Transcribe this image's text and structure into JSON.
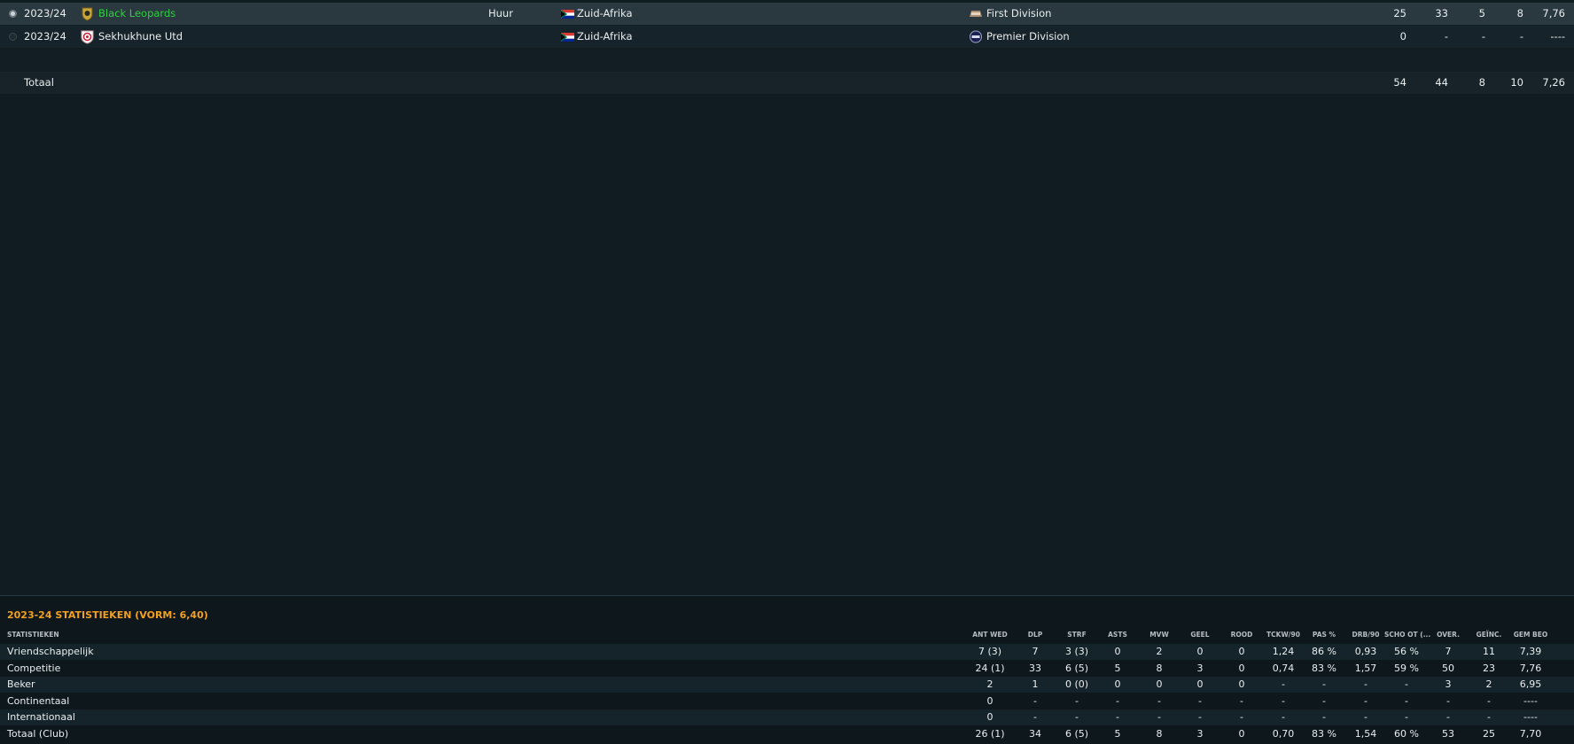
{
  "career": {
    "rows": [
      {
        "season": "2023/24",
        "club": "Black Leopards",
        "club_color": "#2ed03e",
        "loan": "Huur",
        "nation": "Zuid-Afrika",
        "league": "First Division",
        "v1": "25",
        "v2": "33",
        "v3": "5",
        "v4": "8",
        "v5": "7,76",
        "selected": true
      },
      {
        "season": "2023/24",
        "club": "Sekhukhune Utd",
        "club_color": "#e9eef0",
        "loan": "",
        "nation": "Zuid-Afrika",
        "league": "Premier Division",
        "v1": "0",
        "v2": "-",
        "v3": "-",
        "v4": "-",
        "v5": "----",
        "selected": false
      }
    ],
    "total": {
      "label": "Totaal",
      "v1": "54",
      "v2": "44",
      "v3": "8",
      "v4": "10",
      "v5": "7,26"
    }
  },
  "stats": {
    "title": "2023-24 STATISTIEKEN (VORM: 6,40)",
    "row_header": "STATISTIEKEN",
    "columns": [
      "ANT WED",
      "DLP",
      "STRF",
      "ASTS",
      "MVW",
      "GEEL",
      "ROOD",
      "TCKW/90",
      "PAS %",
      "DRB/90",
      "SCHO OT (...",
      "OVER.",
      "GEÏNC.",
      "GEM BEO"
    ],
    "rows": [
      {
        "label": "Vriendschappelijk",
        "values": [
          "7 (3)",
          "7",
          "3 (3)",
          "0",
          "2",
          "0",
          "0",
          "1,24",
          "86 %",
          "0,93",
          "56 %",
          "7",
          "11",
          "7,39"
        ]
      },
      {
        "label": "Competitie",
        "values": [
          "24 (1)",
          "33",
          "6 (5)",
          "5",
          "8",
          "3",
          "0",
          "0,74",
          "83 %",
          "1,57",
          "59 %",
          "50",
          "23",
          "7,76"
        ]
      },
      {
        "label": "Beker",
        "values": [
          "2",
          "1",
          "0 (0)",
          "0",
          "0",
          "0",
          "0",
          "-",
          "-",
          "-",
          "-",
          "3",
          "2",
          "6,95"
        ]
      },
      {
        "label": "Continentaal",
        "values": [
          "0",
          "-",
          "-",
          "-",
          "-",
          "-",
          "-",
          "-",
          "-",
          "-",
          "-",
          "-",
          "-",
          "----"
        ]
      },
      {
        "label": "Internationaal",
        "values": [
          "0",
          "-",
          "-",
          "-",
          "-",
          "-",
          "-",
          "-",
          "-",
          "-",
          "-",
          "-",
          "-",
          "----"
        ]
      },
      {
        "label": "Totaal (Club)",
        "values": [
          "26 (1)",
          "34",
          "6 (5)",
          "5",
          "8",
          "3",
          "0",
          "0,70",
          "83 %",
          "1,54",
          "60 %",
          "53",
          "25",
          "7,70"
        ]
      }
    ]
  }
}
